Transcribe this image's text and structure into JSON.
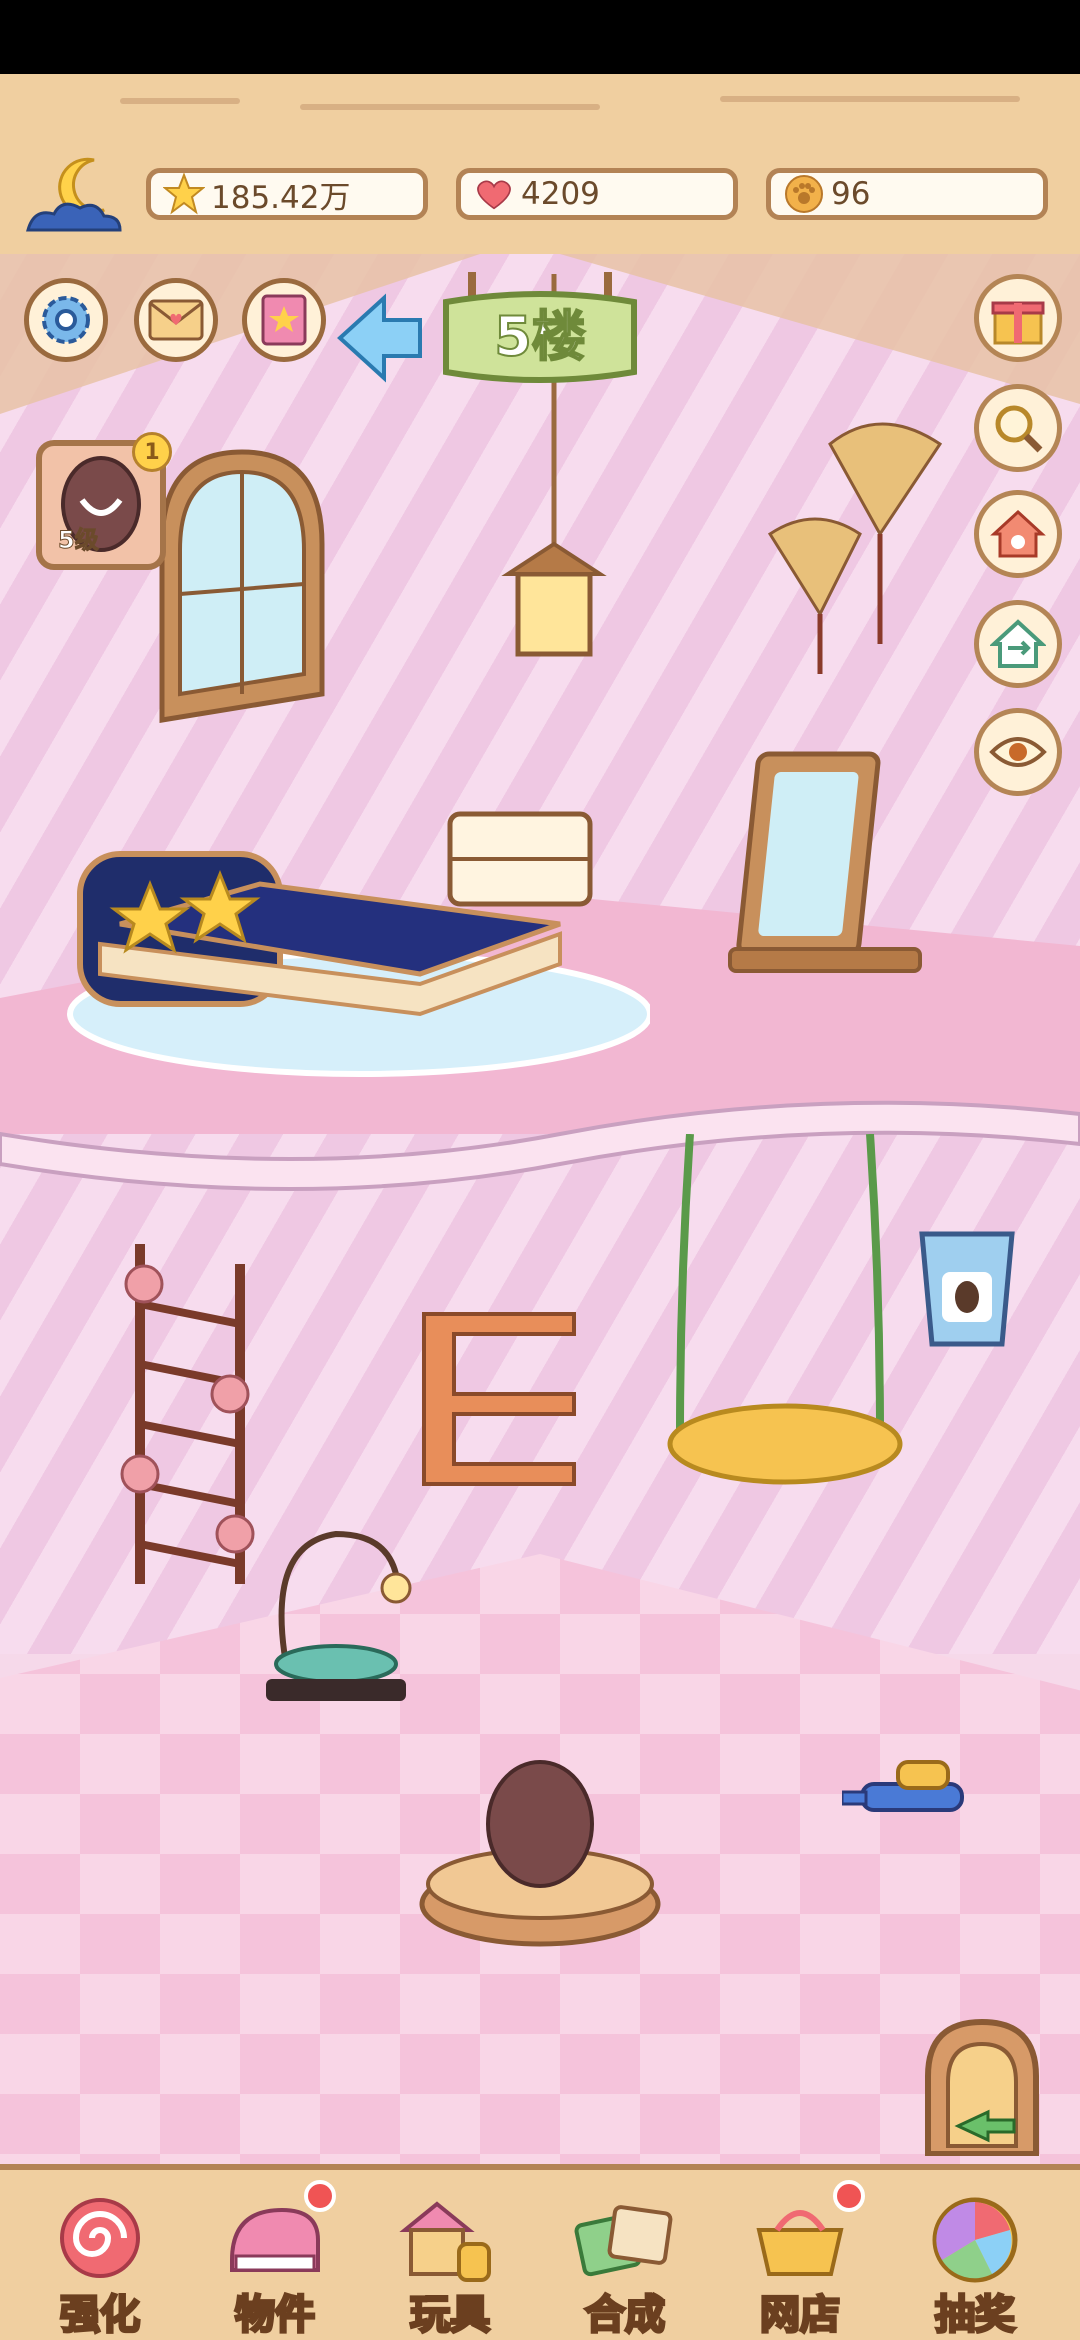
{
  "header": {
    "night_mode_icon": "moon-cloud-icon",
    "stars": {
      "icon": "star-icon",
      "value": "185.42万"
    },
    "hearts": {
      "icon": "heart-icon",
      "value": "4209"
    },
    "paw_coins": {
      "icon": "paw-coin-icon",
      "value": "96"
    }
  },
  "top_buttons": {
    "settings_icon": "gear-icon",
    "mail_icon": "mail-icon",
    "book_icon": "book-icon",
    "back_icon": "arrow-left-icon",
    "gift_icon": "gift-icon"
  },
  "floor": {
    "label": "5楼"
  },
  "pet_card": {
    "level": "5级",
    "badge": "1"
  },
  "side_buttons": [
    "search-icon",
    "house-icon",
    "house-swap-icon",
    "eye-icon"
  ],
  "bottom_nav": [
    {
      "label": "强化",
      "icon": "lollipop-icon",
      "badge": false
    },
    {
      "label": "物件",
      "icon": "piano-icon",
      "badge": true
    },
    {
      "label": "玩具",
      "icon": "toy-house-icon",
      "badge": false
    },
    {
      "label": "合成",
      "icon": "cards-icon",
      "badge": false
    },
    {
      "label": "网店",
      "icon": "shop-cart-icon",
      "badge": true
    },
    {
      "label": "抽奖",
      "icon": "prize-wheel-icon",
      "badge": false
    }
  ],
  "colors": {
    "wood": "#f0cfa0",
    "wood_border": "#b38355",
    "wall": "#f7dcee",
    "floor": "#f5c3db",
    "accent_green": "#cfe39a"
  }
}
